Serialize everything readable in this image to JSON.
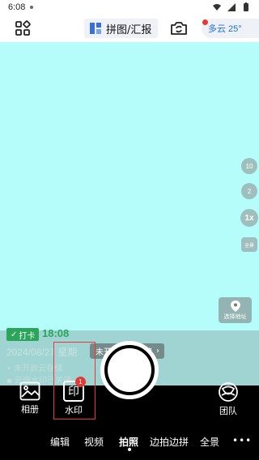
{
  "status_bar": {
    "time": "6:08"
  },
  "top_bar": {
    "collage_label": "拼图/汇报",
    "weather_label": "多云 25°"
  },
  "camera": {
    "zoom_levels": [
      "10",
      "2",
      "1x"
    ],
    "panorama_label": "全景",
    "location_label": "选择地址"
  },
  "watermark": {
    "punch_label": "打卡",
    "time": "18:08",
    "date": "2024/08/27 星期",
    "line1": "未开启云存储",
    "line2": "云端水印已关闭",
    "cloud_storage_label": "未开启云端存储"
  },
  "bottom": {
    "album_label": "相册",
    "watermark_label": "水印",
    "watermark_badge": "1",
    "team_label": "团队"
  },
  "modes": [
    "编辑",
    "视频",
    "拍照",
    "边拍边拼",
    "全景"
  ],
  "active_mode": "拍照",
  "colors": {
    "viewfinder": "#b5fdfa",
    "accent_green": "#2aa55a",
    "highlight_red": "#e53935",
    "weather_blue": "#1f6fe0"
  }
}
